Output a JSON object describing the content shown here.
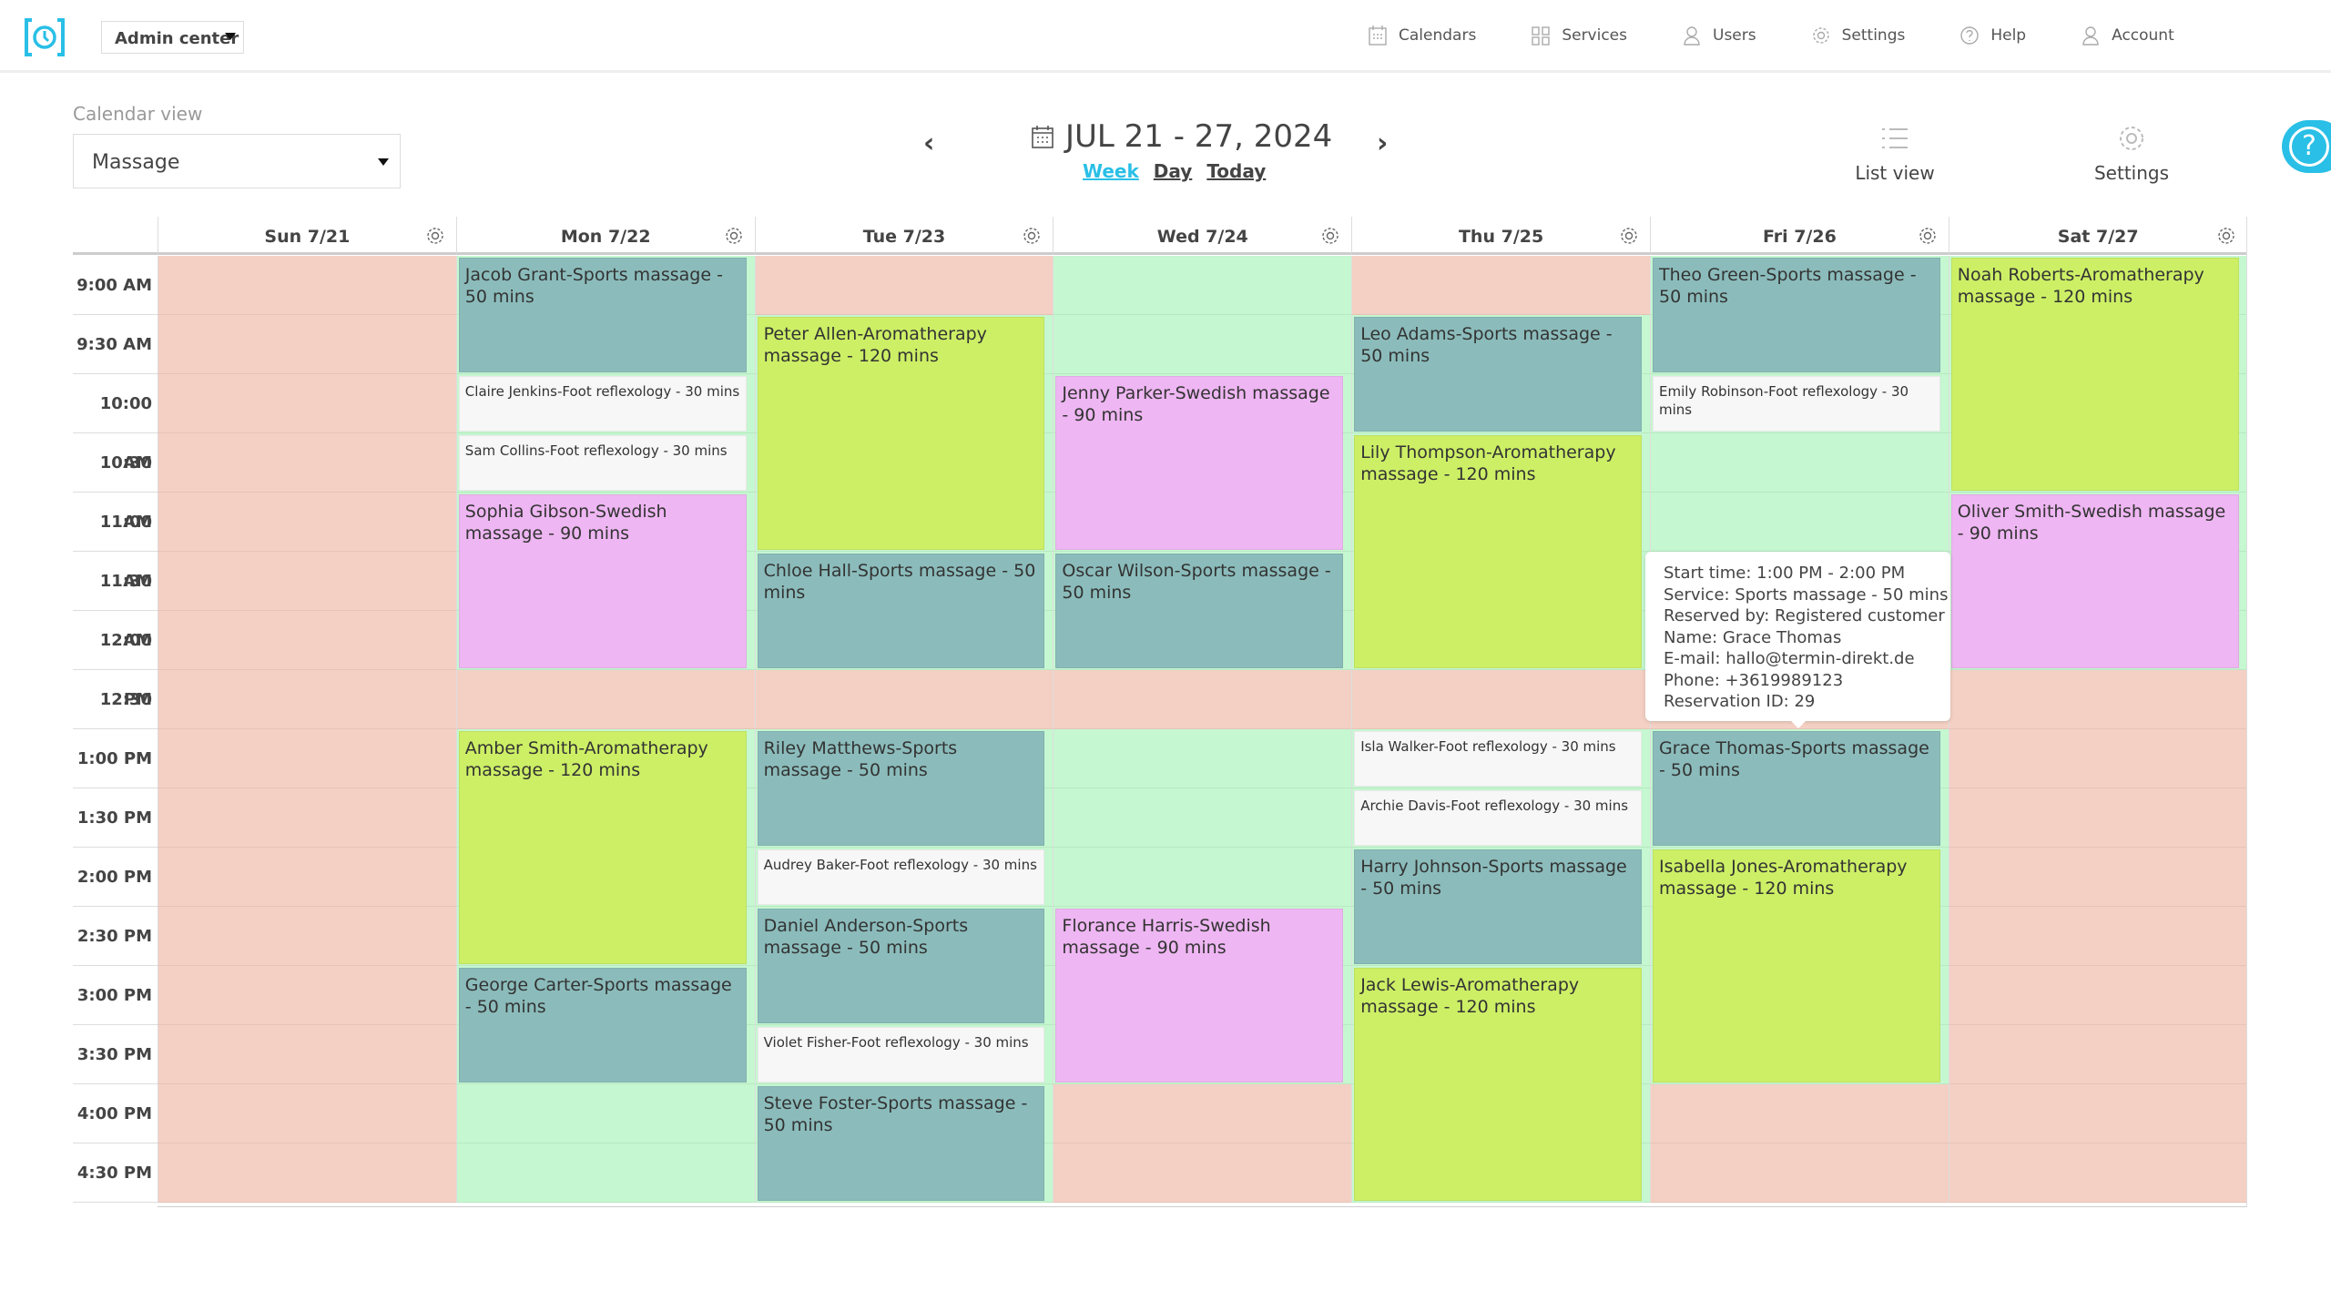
{
  "topbar": {
    "admin_center": "Admin center",
    "nav": [
      {
        "label": "Calendars",
        "icon": "calendar-icon"
      },
      {
        "label": "Services",
        "icon": "grid-icon"
      },
      {
        "label": "Users",
        "icon": "users-icon"
      },
      {
        "label": "Settings",
        "icon": "gear-icon"
      },
      {
        "label": "Help",
        "icon": "help-icon"
      },
      {
        "label": "Account",
        "icon": "account-icon"
      }
    ]
  },
  "calendar_view": {
    "label": "Calendar view",
    "selected": "Massage"
  },
  "date_range": "JUL 21 - 27, 2024",
  "view_links": {
    "week": "Week",
    "day": "Day",
    "today": "Today",
    "active": "week"
  },
  "tools": {
    "list_view": "List view",
    "settings": "Settings"
  },
  "help_bubble": "?",
  "days": [
    "Sun 7/21",
    "Mon 7/22",
    "Tue 7/23",
    "Wed 7/24",
    "Thu 7/25",
    "Fri 7/26",
    "Sat 7/27"
  ],
  "times": [
    "9:00 AM",
    "9:30 AM",
    "10:00 AM",
    "10:30 AM",
    "11:00 AM",
    "11:30 AM",
    "12:00 PM",
    "12:30 PM",
    "1:00 PM",
    "1:30 PM",
    "2:00 PM",
    "2:30 PM",
    "3:00 PM",
    "3:30 PM",
    "4:00 PM",
    "4:30 PM"
  ],
  "availability": [
    "cccccccccccccccc",
    "oooooooc oooooooo",
    "cooooooc oooooooo",
    "oooooooc oooooocc",
    "cooooooc oooooooo",
    "oooooooc oooooocc",
    "oooooooc cccccccc"
  ],
  "colors": {
    "closed": "#f4d0c4",
    "open": "#c5f7d0",
    "sports": "#8bbcbb",
    "aromatherapy": "#cdef66",
    "swedish": "#eeb6f2",
    "foot": "#f7f7f7",
    "accent": "#29bfe6"
  },
  "events": [
    {
      "day": 1,
      "start": 0,
      "slots": 2,
      "type": "sports",
      "text": "Jacob Grant-Sports massage - 50 mins"
    },
    {
      "day": 1,
      "start": 2,
      "slots": 1,
      "type": "foot",
      "text": "Claire Jenkins-Foot reflexology - 30 mins"
    },
    {
      "day": 1,
      "start": 3,
      "slots": 1,
      "type": "foot",
      "text": "Sam Collins-Foot reflexology - 30 mins"
    },
    {
      "day": 1,
      "start": 4,
      "slots": 3,
      "type": "swedish",
      "text": "Sophia Gibson-Swedish massage - 90 mins"
    },
    {
      "day": 1,
      "start": 8,
      "slots": 4,
      "type": "aromatherapy",
      "text": "Amber Smith-Aromatherapy massage - 120 mins"
    },
    {
      "day": 1,
      "start": 12,
      "slots": 2,
      "type": "sports",
      "text": "George Carter-Sports massage - 50 mins"
    },
    {
      "day": 2,
      "start": 1,
      "slots": 4,
      "type": "aromatherapy",
      "text": "Peter Allen-Aromatherapy massage - 120 mins"
    },
    {
      "day": 2,
      "start": 5,
      "slots": 2,
      "type": "sports",
      "text": "Chloe Hall-Sports massage - 50 mins"
    },
    {
      "day": 2,
      "start": 8,
      "slots": 2,
      "type": "sports",
      "text": "Riley Matthews-Sports massage - 50 mins"
    },
    {
      "day": 2,
      "start": 10,
      "slots": 1,
      "type": "foot",
      "text": "Audrey Baker-Foot reflexology - 30 mins"
    },
    {
      "day": 2,
      "start": 11,
      "slots": 2,
      "type": "sports",
      "text": "Daniel Anderson-Sports massage - 50 mins"
    },
    {
      "day": 2,
      "start": 13,
      "slots": 1,
      "type": "foot",
      "text": "Violet Fisher-Foot reflexology - 30 mins"
    },
    {
      "day": 2,
      "start": 14,
      "slots": 2,
      "type": "sports",
      "text": "Steve Foster-Sports massage - 50 mins"
    },
    {
      "day": 3,
      "start": 2,
      "slots": 3,
      "type": "swedish",
      "text": "Jenny Parker-Swedish massage - 90 mins"
    },
    {
      "day": 3,
      "start": 5,
      "slots": 2,
      "type": "sports",
      "text": "Oscar Wilson-Sports massage - 50 mins"
    },
    {
      "day": 3,
      "start": 11,
      "slots": 3,
      "type": "swedish",
      "text": "Florance Harris-Swedish massage - 90 mins"
    },
    {
      "day": 4,
      "start": 1,
      "slots": 2,
      "type": "sports",
      "text": "Leo Adams-Sports massage - 50 mins"
    },
    {
      "day": 4,
      "start": 3,
      "slots": 4,
      "type": "aromatherapy",
      "text": "Lily Thompson-Aromatherapy massage - 120 mins"
    },
    {
      "day": 4,
      "start": 8,
      "slots": 1,
      "type": "foot",
      "text": "Isla Walker-Foot reflexology - 30 mins"
    },
    {
      "day": 4,
      "start": 9,
      "slots": 1,
      "type": "foot",
      "text": "Archie Davis-Foot reflexology - 30 mins"
    },
    {
      "day": 4,
      "start": 10,
      "slots": 2,
      "type": "sports",
      "text": "Harry Johnson-Sports massage - 50 mins"
    },
    {
      "day": 4,
      "start": 12,
      "slots": 4,
      "type": "aromatherapy",
      "text": "Jack Lewis-Aromatherapy massage - 120 mins"
    },
    {
      "day": 5,
      "start": 0,
      "slots": 2,
      "type": "sports",
      "text": "Theo Green-Sports massage - 50 mins"
    },
    {
      "day": 5,
      "start": 2,
      "slots": 1,
      "type": "foot",
      "text": "Emily Robinson-Foot reflexology - 30 mins"
    },
    {
      "day": 5,
      "start": 8,
      "slots": 2,
      "type": "sports",
      "text": "Grace Thomas-Sports massage - 50 mins"
    },
    {
      "day": 5,
      "start": 10,
      "slots": 4,
      "type": "aromatherapy",
      "text": "Isabella Jones-Aromatherapy massage - 120 mins"
    },
    {
      "day": 6,
      "start": 0,
      "slots": 4,
      "type": "aromatherapy",
      "text": "Noah Roberts-Aromatherapy massage - 120 mins"
    },
    {
      "day": 6,
      "start": 4,
      "slots": 3,
      "type": "swedish",
      "text": "Oliver Smith-Swedish massage - 90 mins"
    }
  ],
  "tooltip": {
    "lines": [
      "Start time: 1:00 PM - 2:00 PM",
      "Service: Sports massage - 50 mins",
      "Reserved by: Registered customer",
      "Name: Grace Thomas",
      "E-mail: hallo@termin-direkt.de",
      "Phone: +3619989123",
      "Reservation ID: 29"
    ]
  }
}
